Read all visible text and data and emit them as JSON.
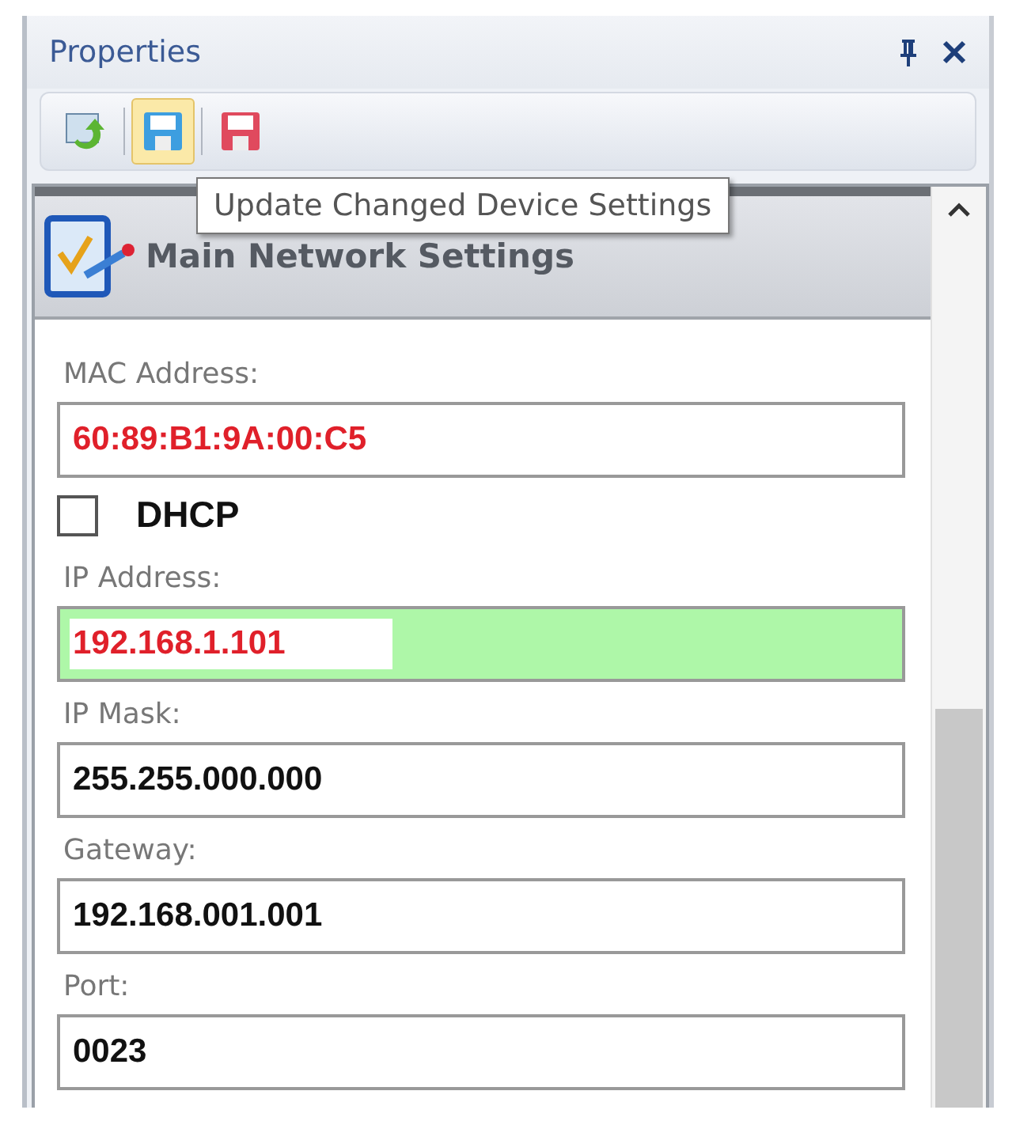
{
  "panel": {
    "title": "Properties"
  },
  "toolbar": [
    {
      "kind": "refresh",
      "hovered": false
    },
    {
      "kind": "save",
      "hovered": true
    },
    {
      "kind": "save-red",
      "hovered": false
    }
  ],
  "tooltip": "Update Changed Device Settings",
  "section": {
    "title": "Main Network Settings"
  },
  "fields": [
    {
      "kind": "text",
      "label": "MAC Address:",
      "value": "60:89:B1:9A:00:C5",
      "changed": true,
      "highlighted": false
    },
    {
      "kind": "checkbox",
      "label": "DHCP",
      "checked": false
    },
    {
      "kind": "text",
      "label": "IP Address:",
      "value": "192.168.1.101",
      "changed": true,
      "highlighted": true
    },
    {
      "kind": "text",
      "label": "IP Mask:",
      "value": "255.255.000.000",
      "changed": false,
      "highlighted": false
    },
    {
      "kind": "text",
      "label": "Gateway:",
      "value": "192.168.001.001",
      "changed": false,
      "highlighted": false
    },
    {
      "kind": "text",
      "label": "Port:",
      "value": "0023",
      "changed": false,
      "highlighted": false
    }
  ]
}
